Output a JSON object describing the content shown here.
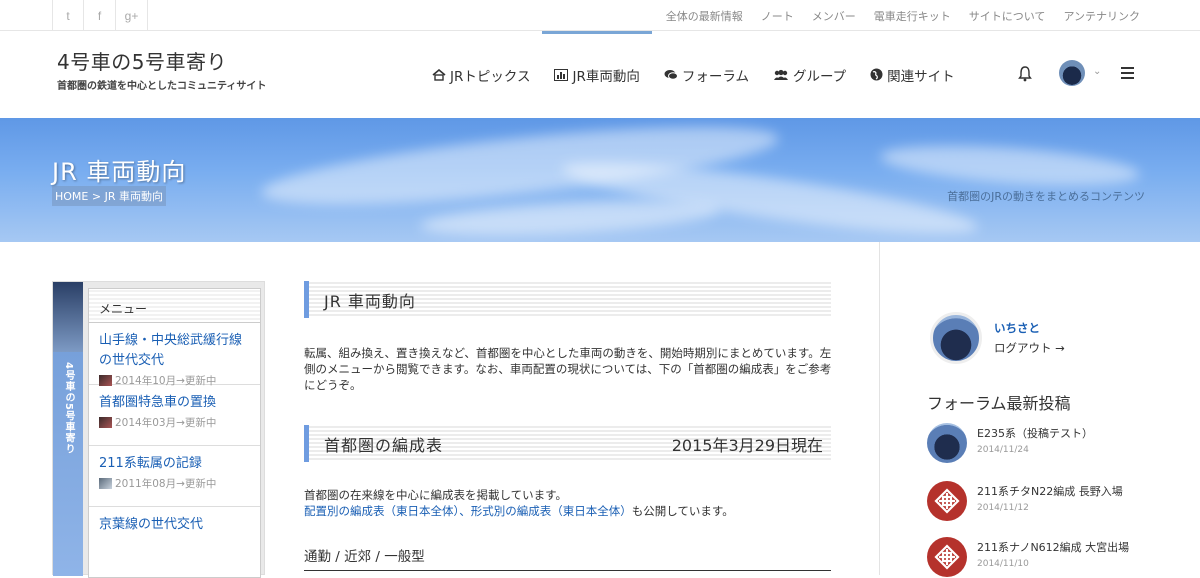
{
  "topbar": {
    "social": [
      "twitter-icon",
      "facebook-icon",
      "google-plus-icon"
    ],
    "social_glyphs": [
      "t",
      "f",
      "g+"
    ],
    "links": [
      "全体の最新情報",
      "ノート",
      "メンバー",
      "電車走行キット",
      "サイトについて",
      "アンテナリンク"
    ]
  },
  "header": {
    "site_title": "4号車の5号車寄り",
    "site_subtitle": "首都圏の鉄道を中心としたコミュニティサイト",
    "nav": [
      {
        "label": "JRトピックス",
        "icon": "house-icon"
      },
      {
        "label": "JR車両動向",
        "icon": "bar-chart-icon",
        "active": true
      },
      {
        "label": "フォーラム",
        "icon": "chat-icon"
      },
      {
        "label": "グループ",
        "icon": "group-icon"
      },
      {
        "label": "関連サイト",
        "icon": "globe-icon"
      }
    ]
  },
  "hero": {
    "title": "JR 車両動向",
    "breadcrumb": "HOME > JR 車両動向",
    "tagline": "首都圏のJRの動きをまとめるコンテンツ"
  },
  "sidebar_left": {
    "vertical_label": "4号車の5号車寄り",
    "heading": "メニュー",
    "items": [
      {
        "title": "山手線・中央総武緩行線の世代交代",
        "meta": "2014年10月→更新中"
      },
      {
        "title": "首都圏特急車の置換",
        "meta": "2014年03月→更新中"
      },
      {
        "title": "211系転属の記録",
        "meta": "2011年08月→更新中"
      },
      {
        "title": "京葉線の世代交代",
        "meta": ""
      }
    ]
  },
  "main": {
    "section1_title": "JR 車両動向",
    "section1_body": "転属、組み換え、置き換えなど、首都圏を中心とした車両の動きを、開始時期別にまとめています。左側のメニューから閲覧できます。なお、車両配置の現状については、下の「首都圏の編成表」をご参考にどうぞ。",
    "section2_title": "首都圏の編成表",
    "section2_date": "2015年3月29日現在",
    "section2_line1": "首都圏の在来線を中心に編成表を掲載しています。",
    "section2_link": "配置別の編成表（東日本全体）、形式別の編成表（東日本全体）",
    "section2_link_suffix": "も公開しています。",
    "subsection": "通勤 / 近郊 / 一般型"
  },
  "sidebar_right": {
    "username": "いちさと",
    "logout": "ログアウト →",
    "forum_title": "フォーラム最新投稿",
    "posts": [
      {
        "title": "E235系（投稿テスト）",
        "date": "2014/11/24",
        "thumb": "photo"
      },
      {
        "title": "211系チタN22編成 長野入場",
        "date": "2014/11/12",
        "thumb": "jr"
      },
      {
        "title": "211系ナノN612編成 大宮出場",
        "date": "2014/11/10",
        "thumb": "jr"
      }
    ]
  },
  "colors": {
    "accent": "#1a5fb4",
    "section_bar": "#6f9ce0",
    "hero_sky": "#7aaef0"
  }
}
